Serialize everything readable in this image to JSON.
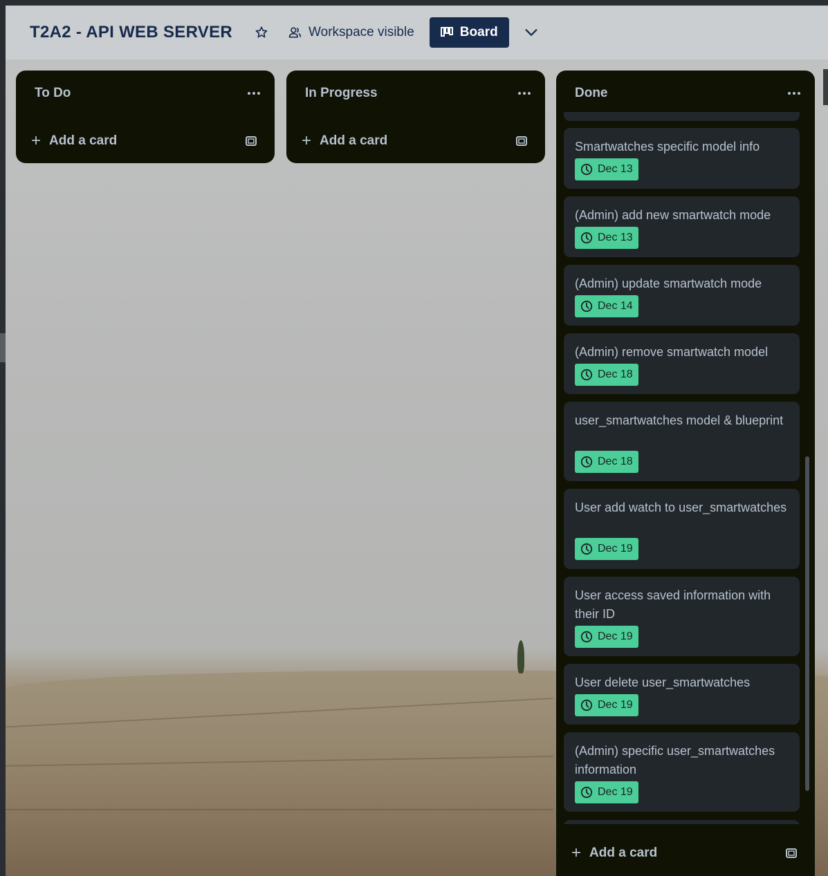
{
  "board": {
    "title": "T2A2 - API WEB SERVER",
    "visibility_label": "Workspace visible",
    "view_label": "Board"
  },
  "lists": [
    {
      "title": "To Do",
      "add_card_label": "Add a card"
    },
    {
      "title": "In Progress",
      "add_card_label": "Add a card"
    },
    {
      "title": "Done",
      "add_card_label": "Add a card"
    }
  ],
  "done_cards": [
    {
      "title": "Smartwatches specific model info",
      "due": "Dec 13"
    },
    {
      "title": "(Admin) add new smartwatch mode",
      "due": "Dec 13"
    },
    {
      "title": "(Admin) update smartwatch mode",
      "due": "Dec 14"
    },
    {
      "title": "(Admin) remove smartwatch model",
      "due": "Dec 18"
    },
    {
      "title": "user_smartwatches model & blueprint",
      "due": "Dec 18"
    },
    {
      "title": "User add watch to user_smartwatches",
      "due": "Dec 19"
    },
    {
      "title": "User access saved information with their ID",
      "due": "Dec 19"
    },
    {
      "title": "User delete user_smartwatches",
      "due": "Dec 19"
    },
    {
      "title": "(Admin) specific user_smartwatches information",
      "due": "Dec 19"
    }
  ],
  "colors": {
    "header_text": "#172b4d",
    "list_bg": "#101204",
    "card_bg": "#22272b",
    "due_badge": "#4bce97",
    "list_text": "#b6c2cf"
  }
}
